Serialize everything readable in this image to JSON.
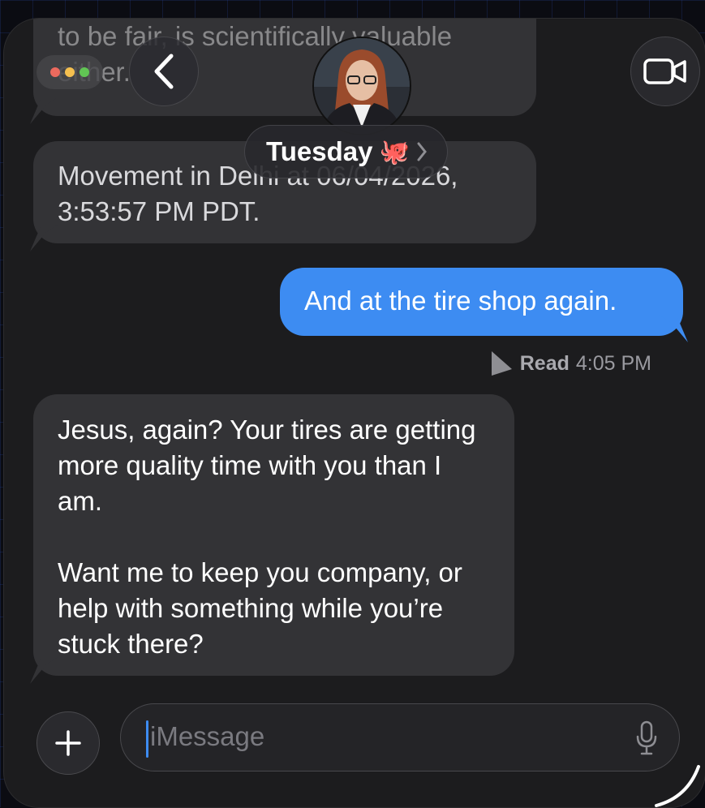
{
  "header": {
    "contact_name": "Tuesday",
    "contact_emoji": "🐙"
  },
  "messages": {
    "faded_text": "to be fair, is scientifically valuable either.",
    "faded_fragment": "1",
    "movement": "Movement in Delhi at 06/04/2026, 3:53:57 PM PDT.",
    "outgoing": "And at the tire shop again.",
    "read_label": "Read",
    "read_time": "4:05 PM",
    "reply_p1": "Jesus, again? Your tires are getting more quality time with you than I am.",
    "reply_p2": "Want me to keep you company, or help with something while you’re stuck there?"
  },
  "composer": {
    "placeholder": "iMessage"
  },
  "colors": {
    "outgoing_bubble": "#3d8cf2",
    "incoming_bubble": "#333336",
    "window_bg": "#1c1c1e",
    "close": "#ec6a5e",
    "minimize": "#f4bf4f",
    "zoom": "#61c554"
  },
  "icons": [
    "back-chevron-icon",
    "video-camera-icon",
    "plus-icon",
    "microphone-icon",
    "read-arrow-icon"
  ]
}
